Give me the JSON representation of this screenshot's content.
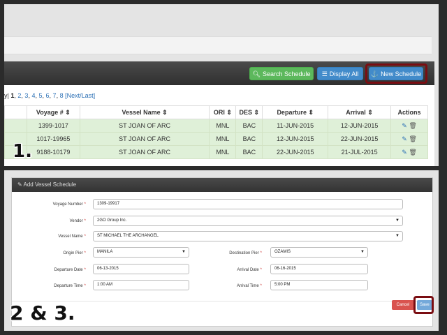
{
  "schedule_list": {
    "buttons": {
      "search": {
        "label": "Search Schedule",
        "icon": "search-icon"
      },
      "display_all": {
        "label": "Display All",
        "icon": "list-icon"
      },
      "new_schedule": {
        "label": "New Schedule",
        "icon": "anchor-icon"
      }
    },
    "pager": {
      "lead": "y|",
      "current": "1",
      "pages": [
        "2",
        "3",
        "4",
        "5",
        "6",
        "7",
        "8"
      ],
      "next_last": "[Next/Last]"
    },
    "columns": [
      "Voyage #",
      "Vessel Name",
      "ORI",
      "DES",
      "Departure",
      "Arrival",
      "Actions"
    ],
    "rows": [
      {
        "voyage": "1399-1017",
        "vessel": "ST JOAN OF ARC",
        "ori": "MNL",
        "des": "BAC",
        "departure": "11-JUN-2015",
        "arrival": "12-JUN-2015"
      },
      {
        "voyage": "1017-19965",
        "vessel": "ST JOAN OF ARC",
        "ori": "MNL",
        "des": "BAC",
        "departure": "12-JUN-2015",
        "arrival": "22-JUN-2015"
      },
      {
        "voyage": "9188-10179",
        "vessel": "ST JOAN OF ARC",
        "ori": "MNL",
        "des": "BAC",
        "departure": "22-JUN-2015",
        "arrival": "21-JUL-2015"
      }
    ],
    "step_label": "1."
  },
  "add_form": {
    "title": "Add Vessel Schedule",
    "fields": {
      "voyage_number": {
        "label": "Voyage Number",
        "value": "1309-19917"
      },
      "vendor": {
        "label": "Vendor",
        "value": "2GO Group Inc."
      },
      "vessel_name": {
        "label": "Vessel Name",
        "value": "ST MICHAEL THE ARCHANGEL"
      },
      "origin_pier": {
        "label": "Origin Pier",
        "value": "MANILA"
      },
      "destination_pier": {
        "label": "Destination Pier",
        "value": "OZAMIS"
      },
      "departure_date": {
        "label": "Departure Date",
        "value": "06-13-2015"
      },
      "arrival_date": {
        "label": "Arrival Date",
        "value": "06-16-2015"
      },
      "departure_time": {
        "label": "Departure Time",
        "value": "1:00 AM"
      },
      "arrival_time": {
        "label": "Arrival Time",
        "value": "5:00 PM"
      }
    },
    "cancel_label": "Cancel",
    "save_label": "Save",
    "step_label": "2 & 3."
  },
  "colors": {
    "highlight": "#7a0d12",
    "green_btn": "#5cb85c",
    "blue_btn": "#428bca",
    "row_bg": "#dff0d8"
  }
}
